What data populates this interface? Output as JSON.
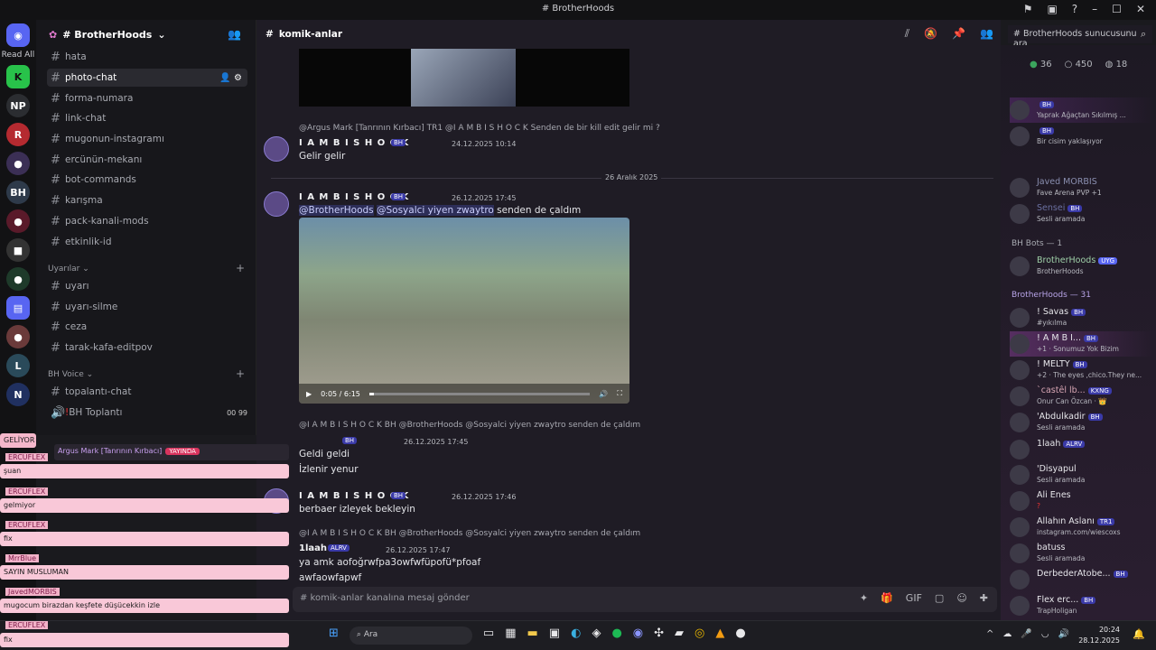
{
  "window": {
    "title": "# BrotherHoods"
  },
  "servers": {
    "read_all": "Read All",
    "np_label": "NP"
  },
  "guild": {
    "name": "# BrotherHoods"
  },
  "channels": [
    {
      "name": "hata"
    },
    {
      "name": "photo-chat"
    },
    {
      "name": "forma-numara"
    },
    {
      "name": "link-chat"
    },
    {
      "name": "mugonun-instagramı"
    },
    {
      "name": "ercünün-mekanı"
    },
    {
      "name": "bot-commands"
    },
    {
      "name": "karışma"
    },
    {
      "name": "pack-kanali-mods"
    },
    {
      "name": "etkinlik-id"
    }
  ],
  "categories": {
    "uyarilar": "Uyarılar",
    "voice": "BH Voice"
  },
  "warn_channels": [
    {
      "name": "uyarı"
    },
    {
      "name": "uyarı-silme"
    },
    {
      "name": "ceza"
    },
    {
      "name": "tarak-kafa-editpov"
    }
  ],
  "voice_channels": [
    {
      "name": "topalantı-chat"
    },
    {
      "name": "BH Toplantı",
      "n1": "00",
      "n2": "99"
    }
  ],
  "chat": {
    "channel": "komik-anlar",
    "search_placeholder": "# BrotherHoods sunucusunu ara",
    "date_divider": "26 Aralık 2025",
    "composer_placeholder": "# komik-anlar kanalına mesaj gönder",
    "messages": [
      {
        "reply": "@Argus Mark [Tanrının Kırbacı]  TR1  @I A M B I S H O C K  Senden de bir kill edit gelir mi ?",
        "user": "I A M B I S H O C K",
        "tag": "BH",
        "time": "24.12.2025 10:14",
        "text": "Gelir gelir"
      },
      {
        "user": "I A M B I S H O C K",
        "tag": "BH",
        "time": "26.12.2025 17:45",
        "mention1": "@BrotherHoods",
        "mention2": "@Sosyalci yiyen zwaytro",
        "text": "senden de çaldım"
      },
      {
        "reply": "@I A M B I S H O C K  BH  @BrotherHoods @Sosyalci yiyen zwaytro senden de çaldım",
        "tag": "BH",
        "time": "26.12.2025 17:45",
        "line1": "Geldi geldi",
        "line2": "İzlenir yenur"
      },
      {
        "user": "I A M B I S H O C K",
        "tag": "BH",
        "time": "26.12.2025 17:46",
        "text": "berbaer izleyek bekleyin"
      },
      {
        "reply": "@I A M B I S H O C K  BH  @BrotherHoods @Sosyalci yiyen zwaytro senden de çaldım",
        "user": "1laah",
        "tag": "ALRV",
        "time": "26.12.2025 17:47",
        "line1": "ya amk aofoğrwfpa3owfwfüpofü*pfoaf",
        "line2": "awfaowfapwf"
      }
    ],
    "video": {
      "time": "0:05 / 6:15"
    }
  },
  "members": {
    "online": "36",
    "total": "450",
    "count3": "18",
    "bots_header": "BH Bots — 1",
    "hoods_header": "BrotherHoods — 31",
    "list_top": [
      {
        "name": "",
        "tag": "BH",
        "status": "Yaprak Ağaçtan Sıkılmış ..."
      },
      {
        "name": "",
        "tag": "BH",
        "status": "Bir cisim yaklaşıyor"
      },
      {
        "name": "Javed MORBIS",
        "tag": "",
        "status": "Fave Arena PVP +1"
      },
      {
        "name": "Sensei",
        "tag": "BH",
        "status": "Sesli aramada"
      }
    ],
    "bot": {
      "name": "BrotherHoods",
      "tag": "UYG",
      "status": "BrotherHoods"
    },
    "list": [
      {
        "name": "! Savas",
        "tag": "BH",
        "status": "#yıkılma"
      },
      {
        "name": "! A M B I...",
        "tag": "BH",
        "status": "+1 · Sonumuz Yok Bizim"
      },
      {
        "name": "! MELTY",
        "tag": "BH",
        "status": "+2 · The eyes ,chico.They ne..."
      },
      {
        "name": "`castêl lb...",
        "tag": "KXNG",
        "status": "Onur Can Özcan · 👑"
      },
      {
        "name": "'Abdulkadir",
        "tag": "BH",
        "status": "Sesli aramada"
      },
      {
        "name": "1laah",
        "tag": "ALRV",
        "status": ""
      },
      {
        "name": "'Disyapul",
        "tag": "",
        "status": "Sesli aramada"
      },
      {
        "name": "Ali Enes",
        "tag": "",
        "status": "?"
      },
      {
        "name": "Allahın Aslanı",
        "tag": "TR1",
        "status": "instagram.com/wiescoxs"
      },
      {
        "name": "batuss",
        "tag": "",
        "status": "Sesli aramada"
      },
      {
        "name": "DerbederAtobe...",
        "tag": "BH",
        "status": ""
      },
      {
        "name": "Flex erc...",
        "tag": "BH",
        "status": "TrapHoligan"
      }
    ]
  },
  "overlay": {
    "rows": [
      {
        "user": "",
        "text": "GELİYOR"
      },
      {
        "user": "ERCUFLEX",
        "text": "şuan"
      },
      {
        "user": "ERCUFLEX",
        "text": "gelmiyor"
      },
      {
        "user": "ERCUFLEX",
        "text": "fix"
      },
      {
        "user": "MrrBlue",
        "text": "SAYIN MUSLUMAN"
      },
      {
        "user": "JavedMORBIS",
        "text": "mugocum birazdan keşfete düşücekkin izle"
      },
      {
        "user": "ERCUFLEX",
        "text": "fix"
      }
    ],
    "live_user": "Argus Mark [Tanrının Kırbacı]",
    "live_label": "YAYINDA"
  },
  "taskbar": {
    "search": "Ara",
    "time": "20:24",
    "date": "28.12.2025"
  },
  "colors": {
    "accent": "#5865f2",
    "overlay_pink": "#f9c8d8",
    "live": "#d8345e"
  }
}
